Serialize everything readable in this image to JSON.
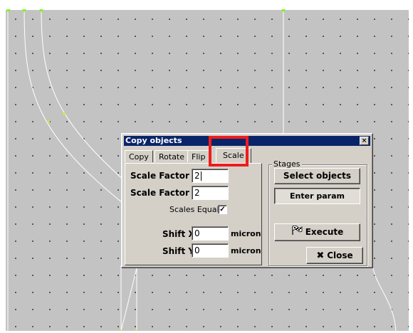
{
  "dialog": {
    "title": "Copy objects",
    "close_glyph": "×",
    "tabs": [
      {
        "label": "Copy"
      },
      {
        "label": "Rotate"
      },
      {
        "label": "Flip"
      },
      {
        "label": "Scale",
        "active": true
      }
    ],
    "scale": {
      "factor_x_label": "Scale Factor X",
      "factor_x_value": "2",
      "factor_y_label": "Scale Factor Y",
      "factor_y_value": "2",
      "scales_equal_label": "Scales Equal",
      "scales_equal_checked": "✓",
      "shift_x_label": "Shift X",
      "shift_x_value": "0",
      "shift_x_unit": "micron",
      "shift_y_label": "Shift Y",
      "shift_y_value": "0",
      "shift_y_unit": "micron"
    },
    "stages": {
      "title": "Stages",
      "select_objects_label": "Select objects",
      "enter_param_label": "Enter param",
      "execute_label": "Execute",
      "execute_icon": "checkered-flag-icon"
    },
    "close_button": {
      "label": "Close",
      "icon": "x-mark-icon",
      "glyph": "✖"
    }
  },
  "colors": {
    "canvas": "#c3c3c3",
    "titlebar": "#0a246a",
    "dialog": "#d4d0c8",
    "highlight": "#ee1c1c",
    "vertex": "#7cfc00",
    "curve": "#ffffff"
  }
}
